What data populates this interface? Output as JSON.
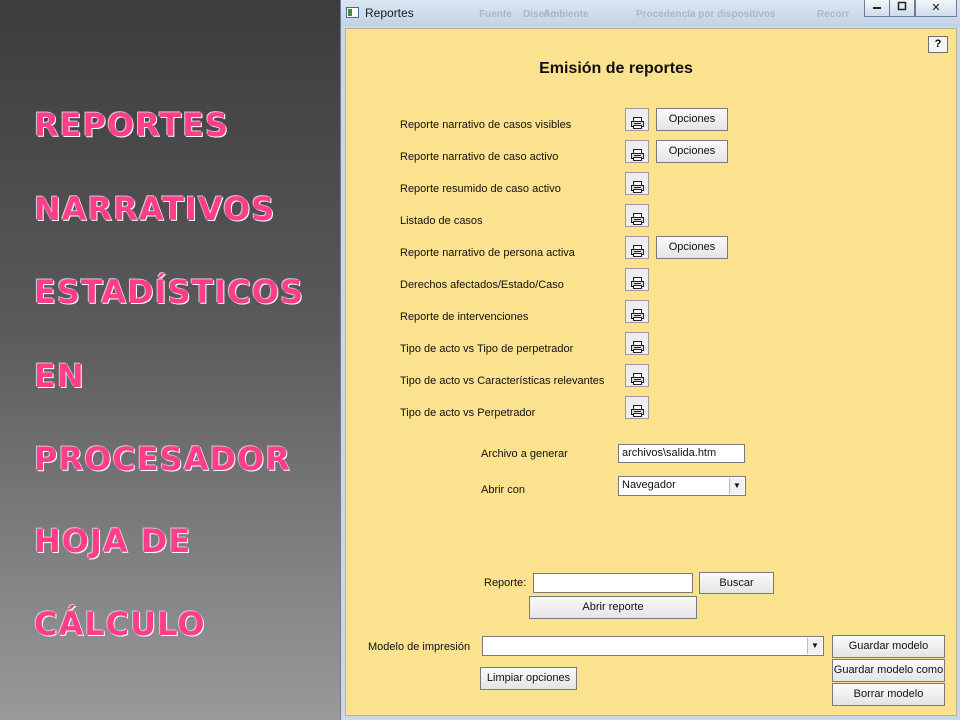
{
  "slide": {
    "lines": [
      "REPORTES",
      "NARRATIVOS",
      " ESTADÍSTICOS",
      "EN",
      " PROCESADOR",
      "HOJA DE",
      "CÁLCULO"
    ]
  },
  "window": {
    "title": "Reportes",
    "background_menu": [
      "Fuente",
      "Diseño",
      "Ambiente",
      "Procedencia por dispositivos",
      "Recorr"
    ],
    "minimize_icon": "minimize-icon",
    "maximize_icon": "maximize-icon",
    "close_icon": "close-icon",
    "close_label": "✕"
  },
  "form": {
    "help_label": "?",
    "title": "Emisión de reportes",
    "colors": {
      "background": "#fbe28e",
      "title_text_pink": "#ff3d8a"
    },
    "reports": [
      {
        "label": "Reporte narrativo de casos visibles",
        "options": "Opciones"
      },
      {
        "label": "Reporte narrativo de caso activo",
        "options": "Opciones"
      },
      {
        "label": "Reporte resumido de caso activo"
      },
      {
        "label": "Listado de casos"
      },
      {
        "label": "Reporte narrativo de persona activa",
        "options": "Opciones"
      },
      {
        "label": "Derechos afectados/Estado/Caso"
      },
      {
        "label": "Reporte de intervenciones"
      },
      {
        "label": "Tipo de acto vs Tipo de perpetrador"
      },
      {
        "label": "Tipo de acto vs Características relevantes"
      },
      {
        "label": "Tipo de acto vs Perpetrador"
      }
    ],
    "print_icon": "printer-icon",
    "archivo_label": "Archivo a generar",
    "archivo_value": "archivos\\salida.htm",
    "abrir_con_label": "Abrir con",
    "abrir_con_value": "Navegador",
    "reporte_label": "Reporte:",
    "reporte_value": "",
    "buscar_label": "Buscar",
    "abrir_reporte_label": "Abrir reporte",
    "modelo_label": "Modelo de impresión",
    "modelo_value": "",
    "guardar_modelo_label": "Guardar modelo",
    "guardar_modelo_como_label": "Guardar modelo como",
    "borrar_modelo_label": "Borrar modelo",
    "limpiar_label": "Limpiar opciones"
  }
}
